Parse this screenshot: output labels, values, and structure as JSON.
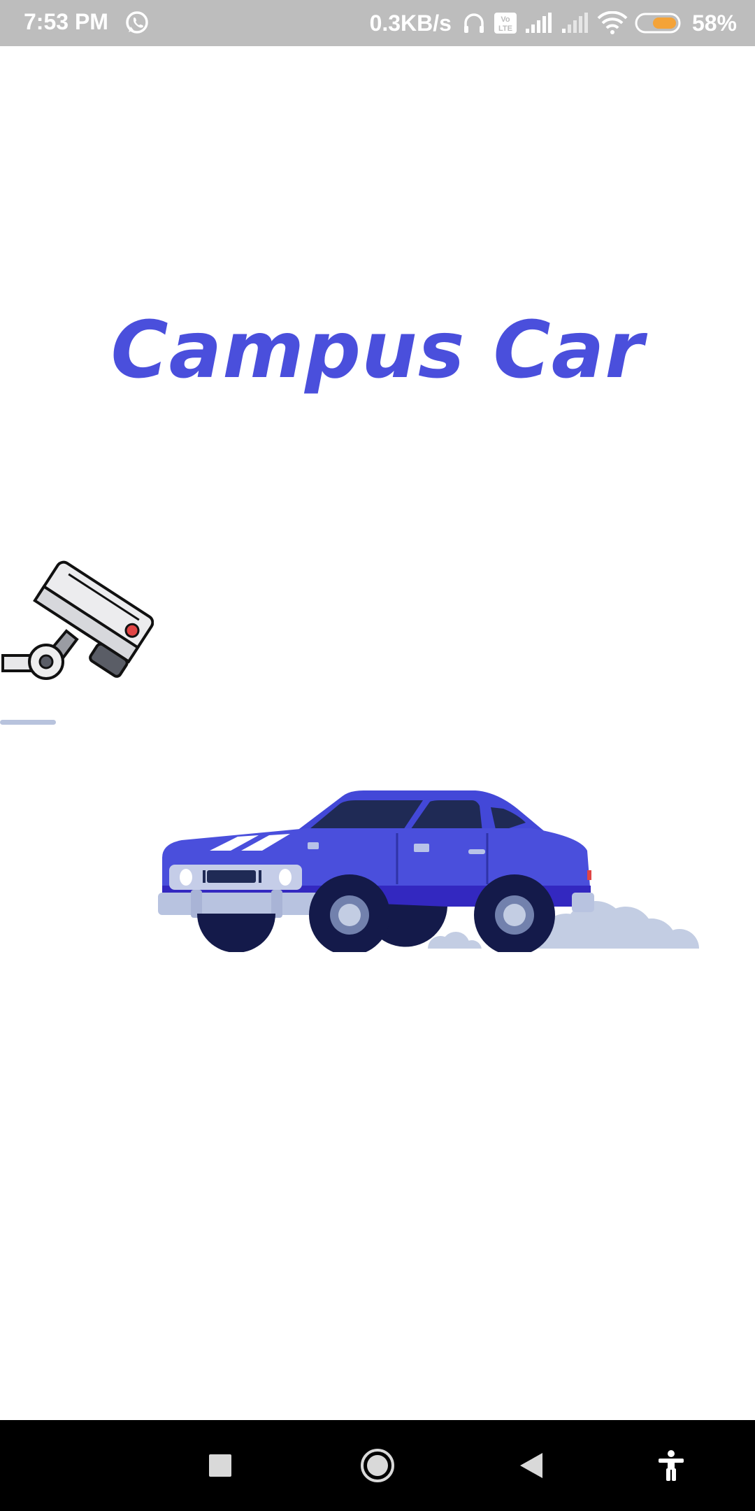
{
  "status_bar": {
    "time": "7:53 PM",
    "net_speed": "0.3KB/s",
    "volte": "Vo LTE",
    "battery_percent": "58%",
    "battery_level": 0.58,
    "icons": [
      "whatsapp-icon",
      "headset-icon",
      "volte-icon",
      "signal-icon",
      "signal-weak-icon",
      "wifi-icon",
      "battery-icon"
    ]
  },
  "splash": {
    "title": "Campus Car",
    "brand_color": "#4a4fdc",
    "illustrations": [
      "security-camera",
      "car"
    ]
  },
  "nav_bar": {
    "buttons": [
      "recents",
      "home",
      "back",
      "accessibility"
    ]
  }
}
